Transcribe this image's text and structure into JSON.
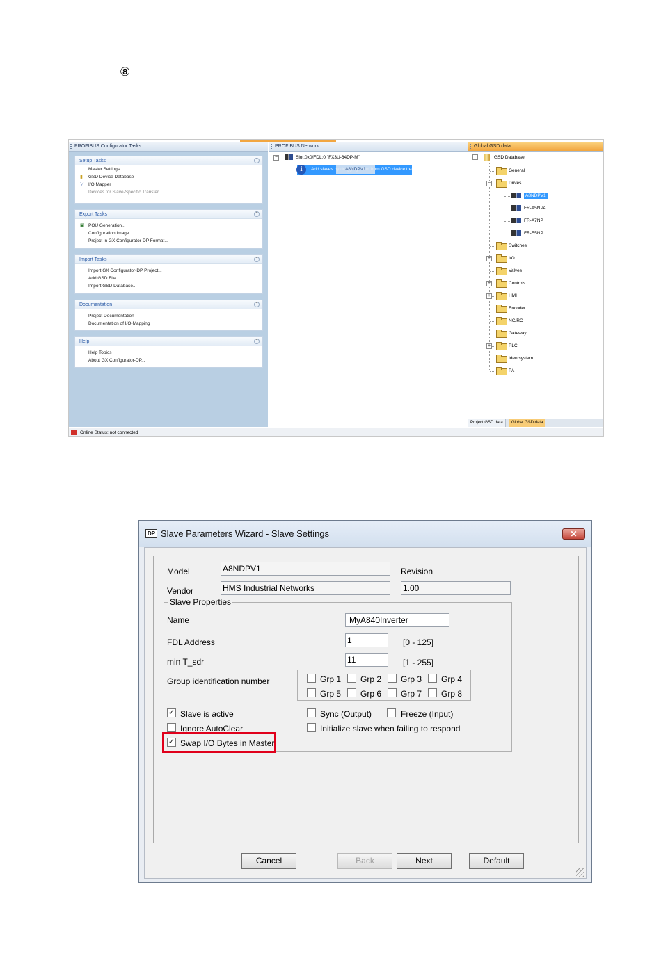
{
  "step_marker": "⑧",
  "configurator": {
    "tasks_title": "PROFIBUS Configurator Tasks",
    "sections": [
      {
        "title": "Setup Tasks",
        "items": [
          "Master Settings...",
          "GSD Device Database",
          "I/O Mapper",
          "Devices for Slave-Specific Transfer..."
        ]
      },
      {
        "title": "Export Tasks",
        "items": [
          "POU Generation...",
          "Configuration Image...",
          "Project in GX Configurator-DP Format..."
        ]
      },
      {
        "title": "Import Tasks",
        "items": [
          "Import GX Configurator-DP Project...",
          "Add GSD File...",
          "Import GSD Database..."
        ]
      },
      {
        "title": "Documentation",
        "items": [
          "Project Documentation",
          "Documentation of I/O-Mapping"
        ]
      },
      {
        "title": "Help",
        "items": [
          "Help Topics",
          "About GX Configurator-DP..."
        ]
      }
    ],
    "network_title": "PROFIBUS Network",
    "network_node": "Slot:0x0/FDL:0 \"FX3U-64DP-M\"",
    "network_hint": "Add slaves by dragging them from GSD device tree",
    "network_drag_label": "A8NDPV1",
    "gsd_title": "Global GSD data",
    "gsd_root": "GSD Database",
    "gsd_folders": [
      "General",
      "Drives",
      "Switches",
      "I/O",
      "Valves",
      "Controls",
      "HMI",
      "Encoder",
      "NC/RC",
      "Gateway",
      "PLC",
      "Identsystem",
      "PA"
    ],
    "drives_children": [
      "A8NDPV1",
      "FR-A5NPA",
      "FR-A7NP",
      "FR-E5NP"
    ],
    "gsd_tabs": [
      "Project GSD data",
      "Global GSD data"
    ],
    "status": "Online Status: not connected"
  },
  "dialog": {
    "logo": "DP",
    "title": "Slave Parameters Wizard - Slave Settings",
    "close_symbol": "✕",
    "model_label": "Model",
    "model_value": "A8NDPV1",
    "revision_label": "Revision",
    "revision_value": "1.00",
    "vendor_label": "Vendor",
    "vendor_value": "HMS Industrial Networks",
    "group_title": "Slave Properties",
    "name_label": "Name",
    "name_value": "MyA840Inverter",
    "fdl_label": "FDL Address",
    "fdl_value": "1",
    "fdl_range": "[0 - 125]",
    "tsdr_label": "min T_sdr",
    "tsdr_value": "11",
    "tsdr_range": "[1 - 255]",
    "group_id_label": "Group identification number",
    "groups": [
      "Grp 1",
      "Grp 2",
      "Grp 3",
      "Grp 4",
      "Grp 5",
      "Grp 6",
      "Grp 7",
      "Grp 8"
    ],
    "options": {
      "slave_active": {
        "label": "Slave is active",
        "checked": true
      },
      "sync": {
        "label": "Sync (Output)",
        "checked": false
      },
      "freeze": {
        "label": "Freeze (Input)",
        "checked": false
      },
      "ignore_autoclear": {
        "label": "Ignore AutoClear",
        "checked": false
      },
      "init_slave": {
        "label": "Initialize slave when failing to respond",
        "checked": false
      },
      "swap_io": {
        "label": "Swap I/O Bytes in Master",
        "checked": true
      }
    },
    "buttons": {
      "cancel": "Cancel",
      "back": "Back",
      "next": "Next",
      "default": "Default"
    },
    "highlight_color": "#e0001b"
  }
}
